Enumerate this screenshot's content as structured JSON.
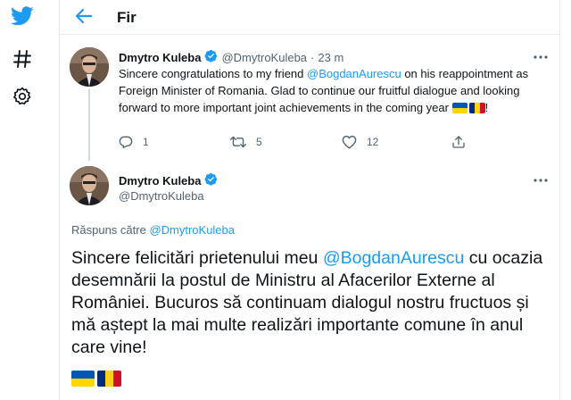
{
  "sidebar": {
    "items": [
      {
        "icon": "twitter-logo-icon"
      },
      {
        "icon": "hashtag-explore-icon"
      },
      {
        "icon": "gear-settings-icon"
      }
    ]
  },
  "header": {
    "back_icon": "arrow-left-icon",
    "title": "Fir"
  },
  "tweet_main": {
    "author_name": "Dmytro Kuleba",
    "verified": true,
    "handle": "@DmytroKuleba",
    "separator": "·",
    "time": "23 m",
    "text_before": "Sincere congratulations to my friend ",
    "mention": "@BogdanAurescu",
    "text_after": " on his reappointment as Foreign Minister of Romania. Glad to continue our fruitful dialogue and looking forward to more important joint achievements in the coming year ",
    "text_end": "!",
    "flags": [
      "ukraine-flag",
      "romania-flag"
    ],
    "replies": "1",
    "retweets": "5",
    "likes": "12"
  },
  "tweet_reply": {
    "author_name": "Dmytro Kuleba",
    "verified": true,
    "handle": "@DmytroKuleba",
    "reply_label": "Răspuns către ",
    "reply_to": "@DmytroKuleba",
    "text_before": "Sincere felicitări prietenului meu ",
    "mention": "@BogdanAurescu",
    "text_after": " cu ocazia desemnării  la postul de Ministru al Afacerilor Externe al României. Bucuros să continuam dialogul nostru fructuos și mă aștept la mai multe realizări importante comune în anul care vine!",
    "flags": [
      "ukraine-flag",
      "romania-flag"
    ]
  },
  "colors": {
    "accent": "#1d9bf0",
    "text": "#0f1419",
    "muted": "#536471",
    "border": "#e6ecf0",
    "ukraine_blue": "#0057b7",
    "ukraine_yellow": "#ffd700",
    "romania_blue": "#002b7f",
    "romania_yellow": "#fcd116",
    "romania_red": "#ce1126"
  }
}
